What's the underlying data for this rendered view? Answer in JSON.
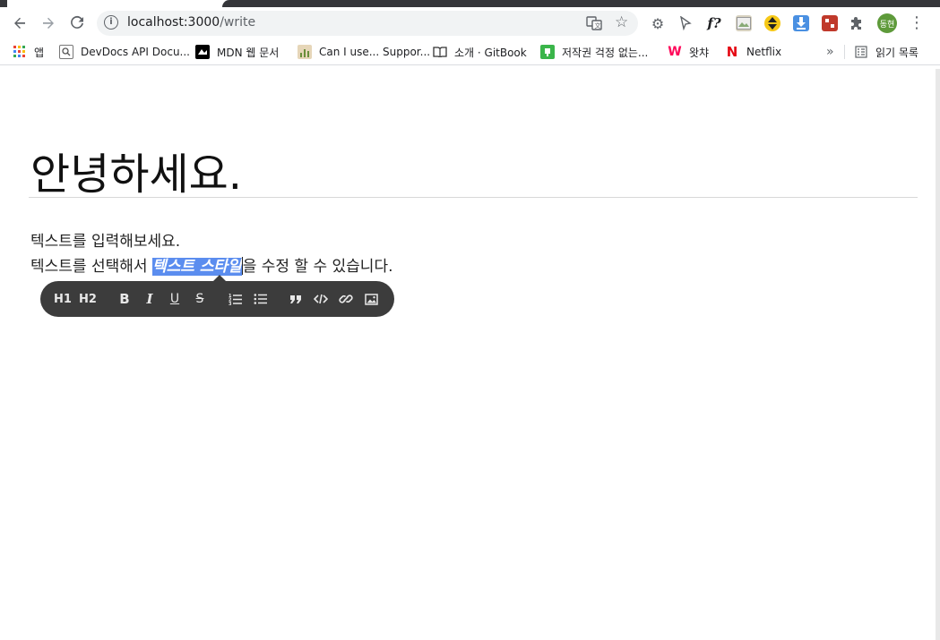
{
  "browser": {
    "url_host": "localhost:3000",
    "url_path": "/write"
  },
  "bookmarks": [
    {
      "label": "앱",
      "icon": "apps-grid-icon"
    },
    {
      "label": "DevDocs API Docu...",
      "icon": "devdocs-icon"
    },
    {
      "label": "MDN 웹 문서",
      "icon": "mdn-icon"
    },
    {
      "label": "Can I use... Suppor...",
      "icon": "caniuse-icon"
    },
    {
      "label": "소개 · GitBook",
      "icon": "gitbook-icon"
    },
    {
      "label": "저작권 걱정 없는...",
      "icon": "copyright-free-icon"
    },
    {
      "label": "왓챠",
      "icon": "watcha-icon"
    },
    {
      "label": "Netflix",
      "icon": "netflix-icon"
    },
    {
      "label": "»",
      "icon": "chevron-double-right-icon"
    },
    {
      "label": "읽기 목록",
      "icon": "reading-list-icon"
    }
  ],
  "profile": {
    "initials": "동현"
  },
  "editor": {
    "title": "안녕하세요.",
    "line1": "텍스트를 입력해보세요.",
    "line2_before": "텍스트를 선택해서 ",
    "line2_selected": "텍스트 스타일",
    "line2_after": "을 수정 할 수 있습니다."
  },
  "format_toolbar": {
    "h1": "H1",
    "h2": "H2",
    "bold": "B",
    "italic": "I",
    "underline": "U",
    "strike": "S",
    "ordered_list_icon": "ordered-list-icon",
    "bullet_list_icon": "bullet-list-icon",
    "quote_icon": "blockquote-icon",
    "code_icon": "code-icon",
    "link_icon": "link-icon",
    "image_icon": "image-icon"
  },
  "colors": {
    "selection": "#5b8def",
    "toolbar_bg": "#3c3c3c"
  }
}
